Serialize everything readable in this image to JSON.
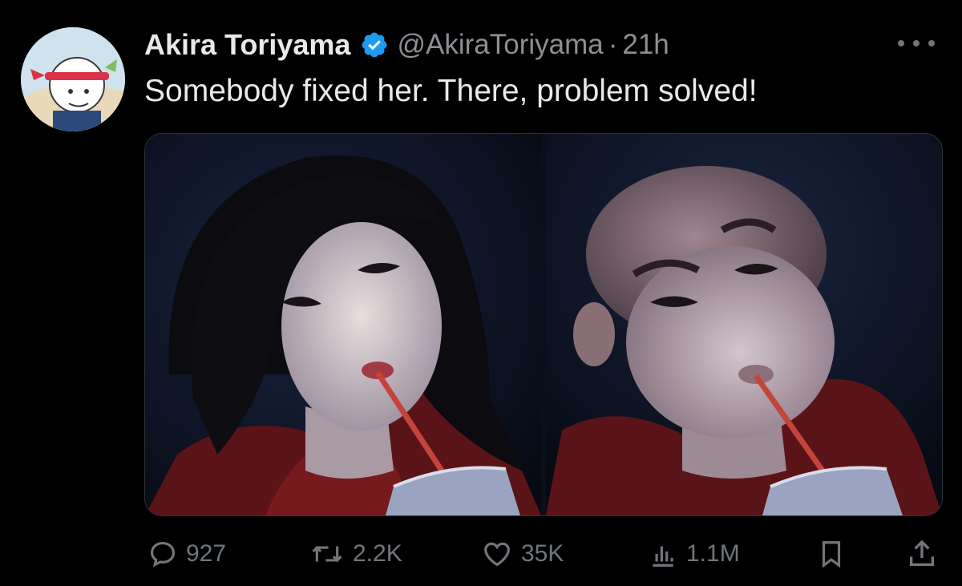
{
  "tweet": {
    "author_name": "Akira Toriyama",
    "author_handle": "@AkiraToriyama",
    "separator": "·",
    "time": "21h",
    "text": "Somebody fixed her. There, problem solved!"
  },
  "media": {
    "count": 2,
    "items": [
      "original-photo",
      "edited-photo"
    ]
  },
  "actions": {
    "replies": "927",
    "reposts": "2.2K",
    "likes": "35K",
    "views": "1.1M"
  },
  "colors": {
    "background": "#000000",
    "primary_text": "#e7e9ea",
    "secondary_text": "#71767b",
    "verified_badge": "#1d9bf0",
    "border": "#2f3336"
  },
  "icons": {
    "verified": "verified-badge-icon",
    "more": "more-options-icon",
    "reply": "reply-icon",
    "repost": "repost-icon",
    "like": "heart-icon",
    "views": "views-icon",
    "bookmark": "bookmark-icon",
    "share": "share-icon"
  }
}
